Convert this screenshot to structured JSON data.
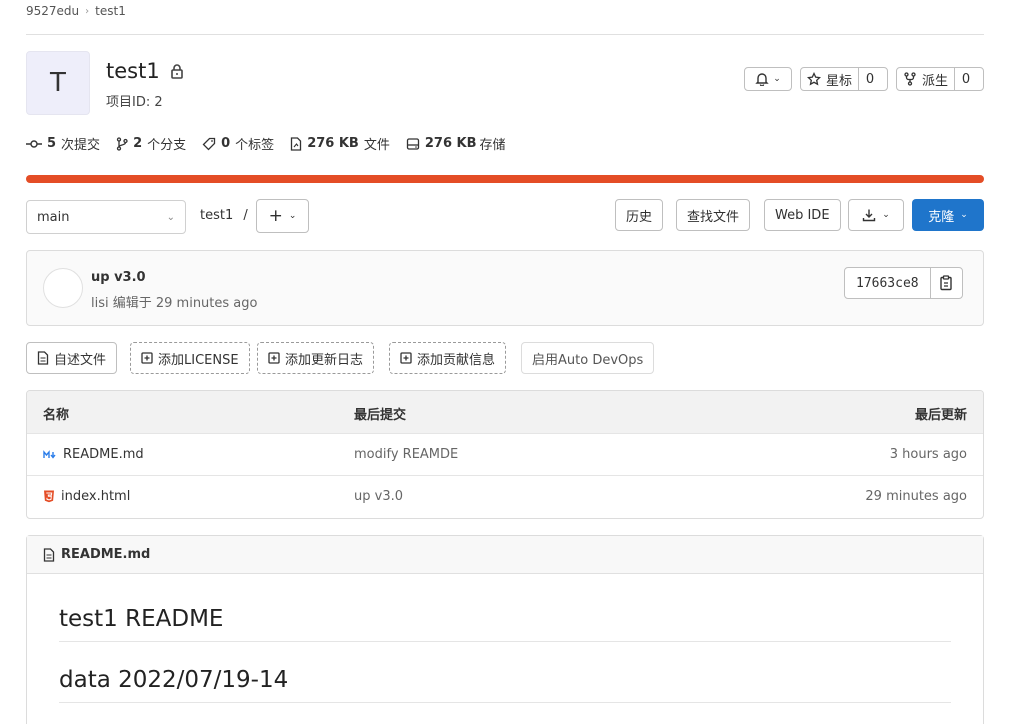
{
  "breadcrumb": {
    "group": "9527edu",
    "project": "test1"
  },
  "project": {
    "avatar_letter": "T",
    "name": "test1",
    "id_label": "项目ID: 2"
  },
  "actions": {
    "star_label": "星标",
    "star_count": "0",
    "fork_label": "派生",
    "fork_count": "0"
  },
  "stats": {
    "commits_num": "5",
    "commits_label": "次提交",
    "branches_num": "2",
    "branches_label": "个分支",
    "tags_num": "0",
    "tags_label": "个标签",
    "files_size": "276 KB",
    "files_label": "文件",
    "storage_size": "276 KB",
    "storage_label": "存储"
  },
  "language_bar": {
    "color": "#e44d26",
    "fraction": 1.0
  },
  "toolbar": {
    "branch": "main",
    "path": "test1",
    "path_sep": "/",
    "history": "历史",
    "find_file": "查找文件",
    "web_ide": "Web IDE",
    "clone": "克隆"
  },
  "last_commit": {
    "title": "up v3.0",
    "meta": "lisi 编辑于 29 minutes ago",
    "sha": "17663ce8"
  },
  "quick_actions": {
    "readme": "自述文件",
    "license": "添加LICENSE",
    "changelog": "添加更新日志",
    "contributing": "添加贡献信息",
    "autodevops": "启用Auto DevOps"
  },
  "file_table": {
    "headers": {
      "name": "名称",
      "last_commit": "最后提交",
      "last_update": "最后更新"
    },
    "rows": [
      {
        "name": "README.md",
        "icon": "markdown-icon",
        "commit": "modify REAMDE",
        "updated": "3 hours ago"
      },
      {
        "name": "index.html",
        "icon": "html5-icon",
        "commit": "up v3.0",
        "updated": "29 minutes ago"
      }
    ]
  },
  "readme": {
    "filename": "README.md",
    "heading1": "test1 README",
    "heading2": "data 2022/07/19-14"
  },
  "colors": {
    "primary": "#1f75cb",
    "html": "#e44d26",
    "markdown": "#2b7de9"
  }
}
